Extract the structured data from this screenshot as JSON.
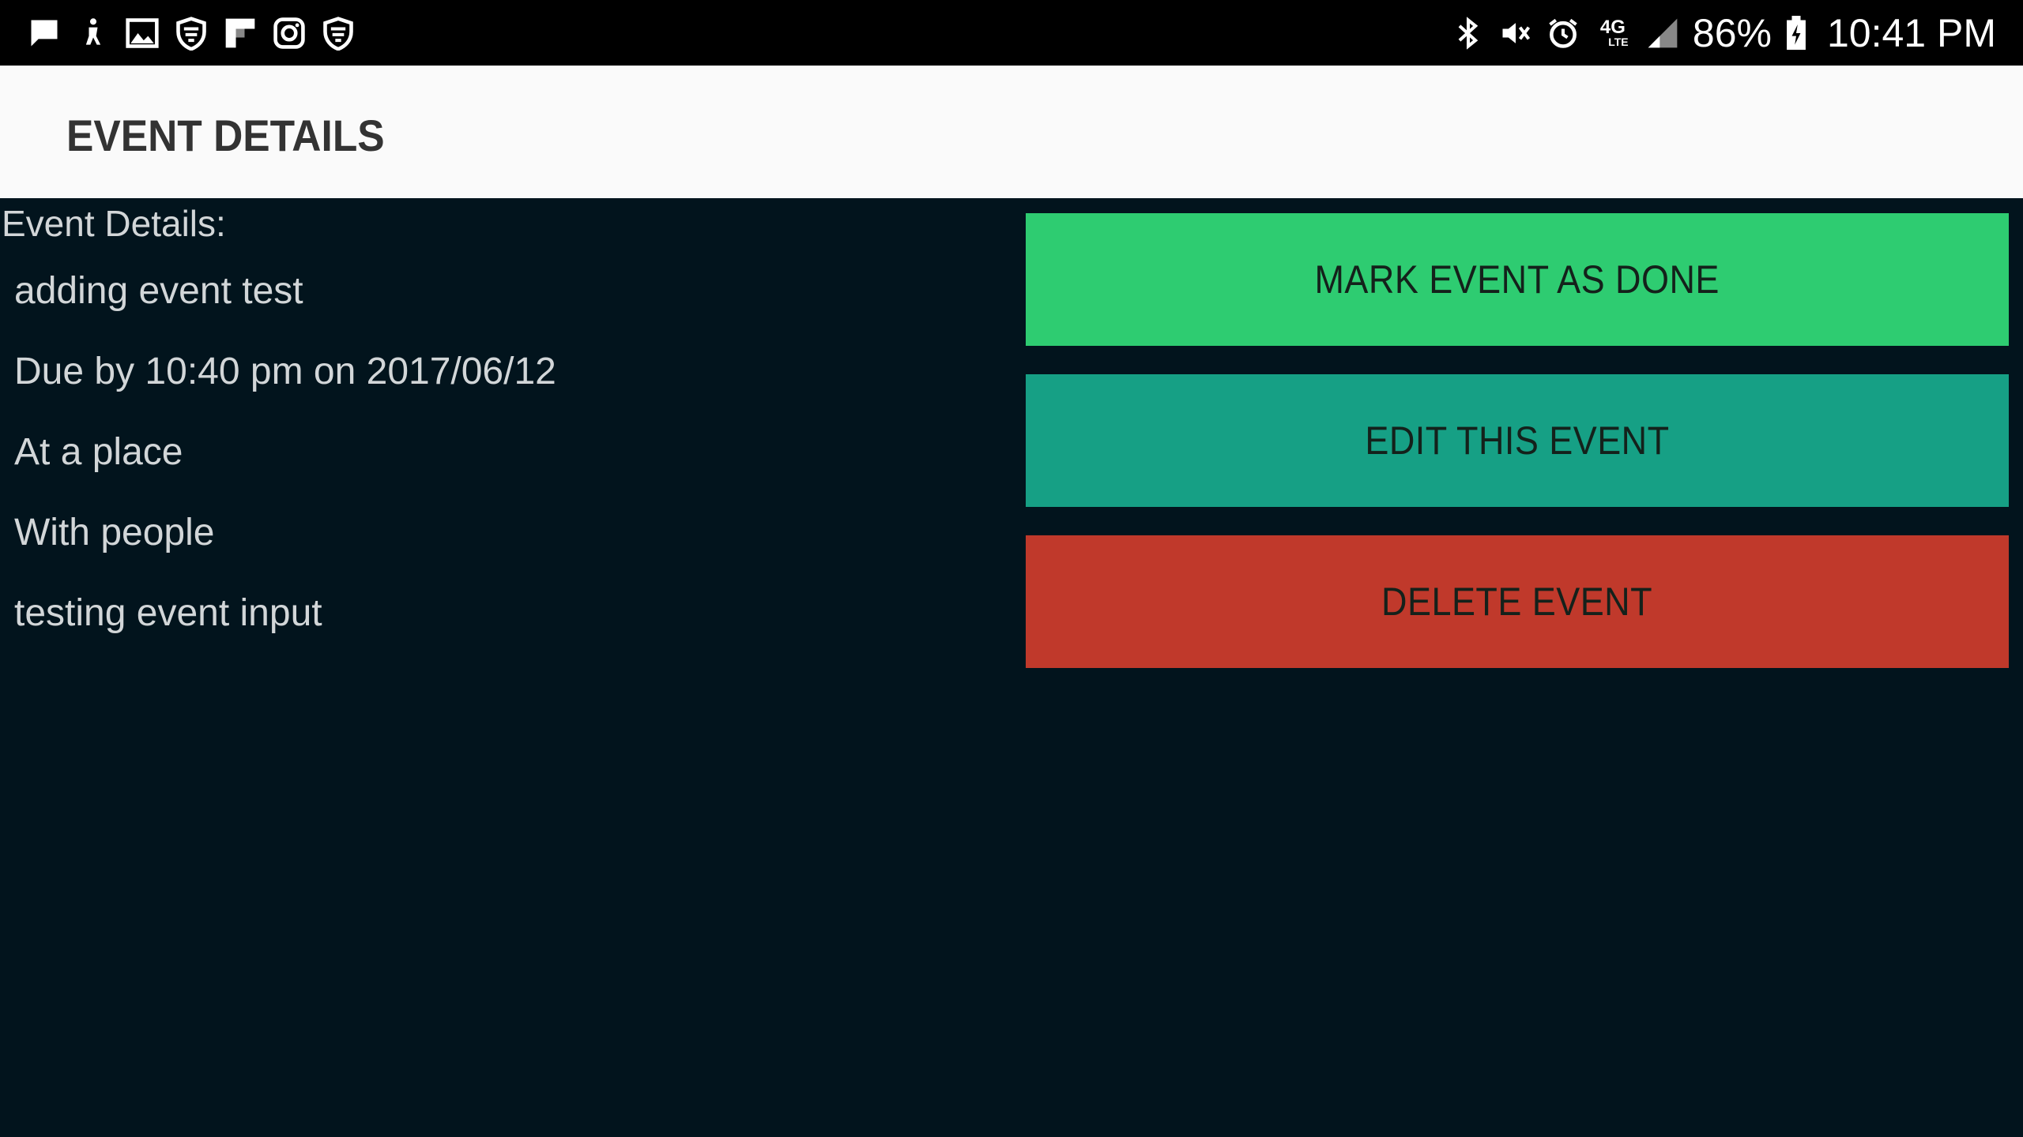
{
  "status_bar": {
    "battery_percent": "86%",
    "time": "10:41 PM",
    "network": "4G",
    "network_sub": "LTE",
    "left_icons": [
      "message-icon",
      "accessibility-icon",
      "image-icon",
      "security-shield-icon",
      "flipboard-icon",
      "instagram-icon",
      "security-shield-icon"
    ],
    "right_icons": [
      "bluetooth-icon",
      "vibrate-mute-icon",
      "alarm-icon",
      "lte-icon",
      "signal-icon",
      "battery-charging-icon"
    ]
  },
  "app_bar": {
    "title": "EVENT DETAILS"
  },
  "details": {
    "heading": "Event Details:",
    "name": "adding event test",
    "due": "Due by 10:40 pm on 2017/06/12",
    "location": "At a place",
    "people": "With people",
    "notes": "testing event input"
  },
  "actions": {
    "mark_done": "MARK EVENT AS DONE",
    "edit": "EDIT THIS EVENT",
    "delete": "DELETE EVENT"
  },
  "colors": {
    "background": "#02141d",
    "app_bar": "#fafafa",
    "mark_done": "#2ecc71",
    "edit": "#16a085",
    "delete": "#c0392b"
  }
}
